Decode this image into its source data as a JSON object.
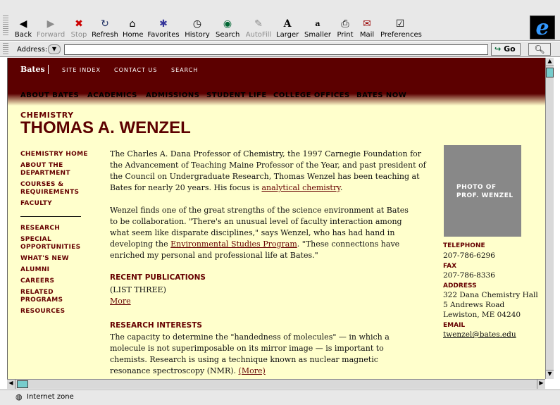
{
  "toolbar": {
    "buttons": [
      {
        "label": "Back",
        "icon": "◀"
      },
      {
        "label": "Forward",
        "icon": "▶"
      },
      {
        "label": "Stop",
        "icon": "✖"
      },
      {
        "label": "Refresh",
        "icon": "↻"
      },
      {
        "label": "Home",
        "icon": "⌂"
      },
      {
        "label": "Favorites",
        "icon": "✱"
      },
      {
        "label": "History",
        "icon": "◷"
      },
      {
        "label": "Search",
        "icon": "◉"
      },
      {
        "label": "AutoFill",
        "icon": "✎"
      },
      {
        "label": "Larger",
        "icon": "A"
      },
      {
        "label": "Smaller",
        "icon": "a"
      },
      {
        "label": "Print",
        "icon": "⎙"
      },
      {
        "label": "Mail",
        "icon": "✉"
      },
      {
        "label": "Preferences",
        "icon": "☑"
      }
    ]
  },
  "address": {
    "label": "Address:",
    "value": "",
    "go_label": "Go"
  },
  "status": {
    "text": "Internet zone"
  },
  "site": {
    "logo": "Bates",
    "top_links": [
      "SITE INDEX",
      "CONTACT US",
      "SEARCH"
    ],
    "nav": [
      "ABOUT BATES",
      "ACADEMICS",
      "ADMISSIONS",
      "STUDENT LIFE",
      "COLLEGE OFFICES",
      "BATES NOW"
    ],
    "department": "CHEMISTRY",
    "name": "THOMAS A. WENZEL",
    "sidenav_top": [
      "CHEMISTRY HOME",
      "ABOUT THE DEPARTMENT",
      "COURSES & REQUIREMENTS",
      "FACULTY"
    ],
    "sidenav_bottom": [
      "RESEARCH",
      "SPECIAL OPPORTUNITIES",
      "WHAT'S NEW",
      "ALUMNI",
      "CAREERS",
      "RELATED PROGRAMS",
      "RESOURCES"
    ],
    "bio1_pre": "The Charles A. Dana Professor of Chemistry, the 1997 Carnegie Foundation for the Advancement of Teaching Maine Professor of the Year, and past president of the Council on Undergraduate Research, Thomas Wenzel has been teaching at Bates for nearly 20 years. His focus is ",
    "bio1_link": "analytical chemistry",
    "bio1_post": ".",
    "bio2_pre": "Wenzel finds one of the great strengths of the science environment at Bates to be collaboration. \"There's an unusual level of faculty interaction among what seem like disparate disciplines,\" says Wenzel, who has had hand in developing the ",
    "bio2_link": "Environmental Studies Program",
    "bio2_post": ". \"These connections have enriched my personal and professional life at Bates.\"",
    "pubs_heading": "RECENT PUBLICATIONS",
    "pubs_text": "(LIST THREE)",
    "more": "More",
    "research_heading": "RESEARCH INTERESTS",
    "research_text": "The capacity to determine the \"handedness of molecules\" — in which a molecule is not superimposable on its mirror image — is important to chemists. Research is using a technique known as nuclear magnetic resonance spectroscopy (NMR).",
    "research_more": "(More)",
    "photo_text": "PHOTO OF PROF. WENZEL",
    "contact": {
      "telephone_label": "TELEPHONE",
      "telephone": "207-786-6296",
      "fax_label": "FAX",
      "fax": "207-786-8336",
      "address_label": "ADDRESS",
      "address_lines": [
        "322 Dana Chemistry Hall",
        "5 Andrews Road",
        "Lewiston, ME 04240"
      ],
      "email_label": "EMAIL",
      "email": "twenzel@bates.edu"
    }
  }
}
